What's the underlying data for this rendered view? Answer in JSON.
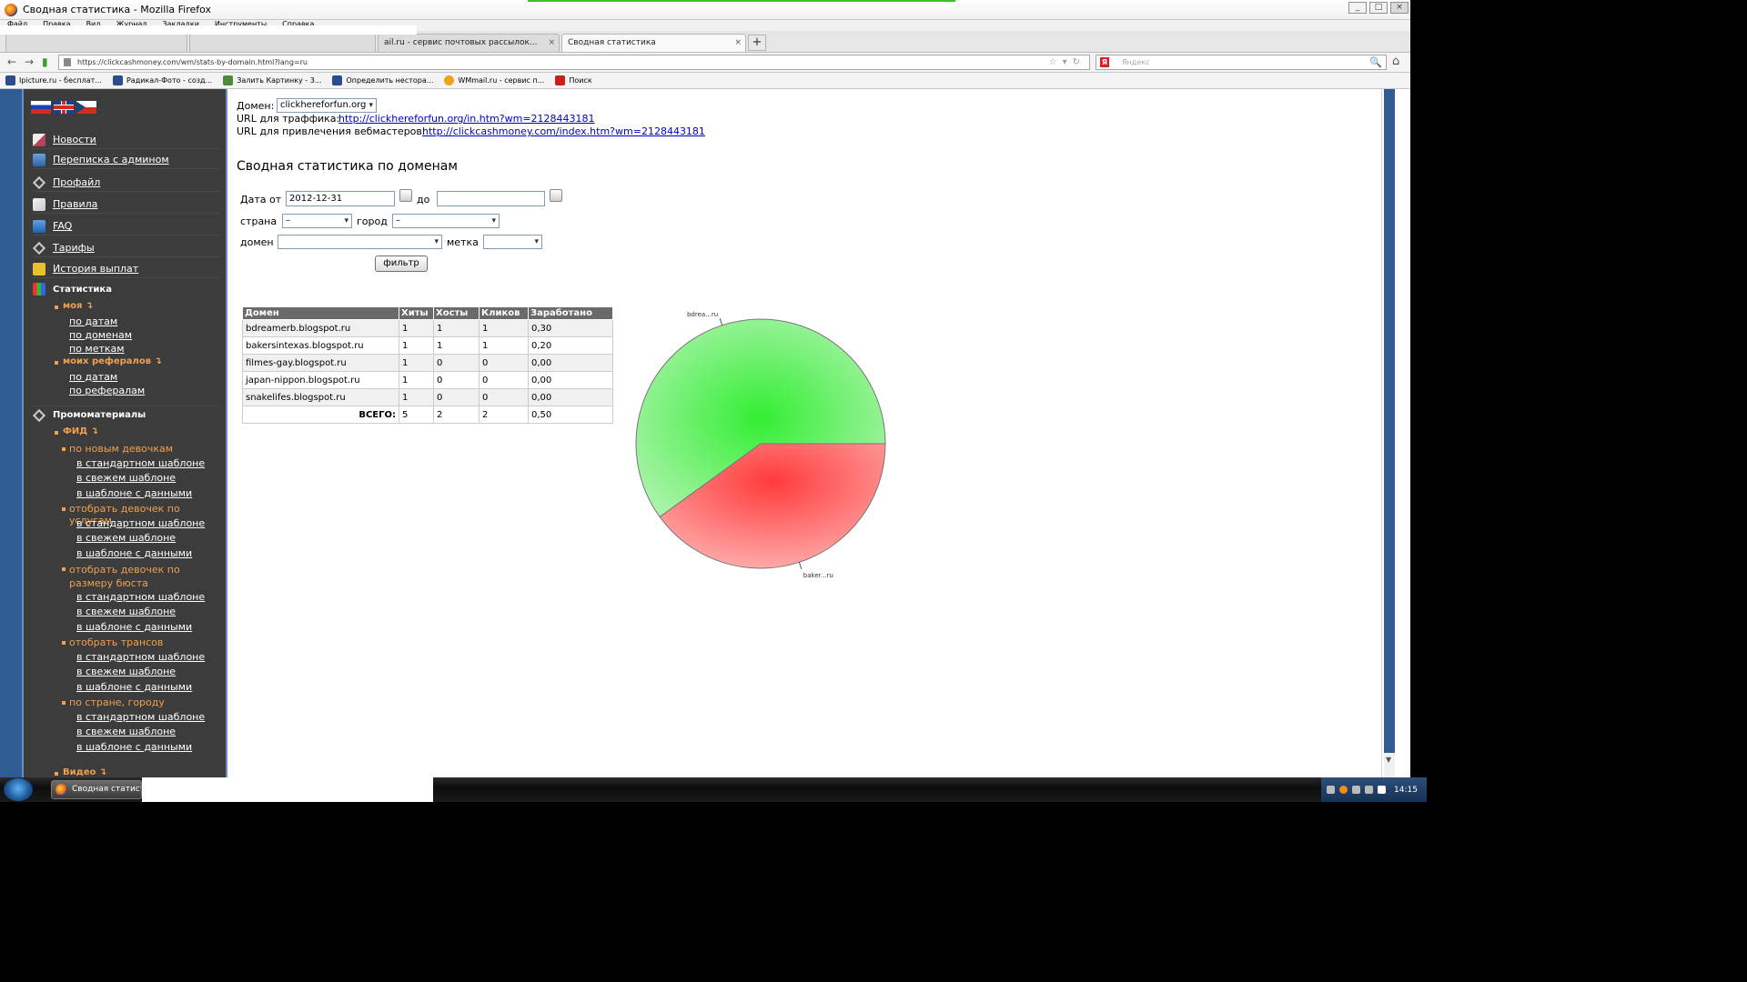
{
  "window": {
    "title": "Сводная статистика - Mozilla Firefox",
    "controls": [
      "_",
      "□",
      "×"
    ]
  },
  "menu": [
    "Файл",
    "Правка",
    "Вид",
    "Журнал",
    "Закладки",
    "Инструменты",
    "Справка"
  ],
  "tabs": [
    {
      "label": "",
      "active": false
    },
    {
      "label": "",
      "active": false
    },
    {
      "label": "ail.ru - сервис почтовых рассылок...",
      "active": false
    },
    {
      "label": "Сводная статистика",
      "active": true
    }
  ],
  "tab_close": "×",
  "new_tab": "+",
  "navbar": {
    "back": "←",
    "forward": "→",
    "url": "https://clickcashmoney.com/wm/stats-by-domain.html?lang=ru",
    "url_icons": "☆▾↻",
    "search_placeholder": "Яндекс",
    "search_engine": "Я",
    "search_icon": "🔍",
    "home_icon": "⌂"
  },
  "bookmarks": [
    {
      "label": "Ipicture.ru - бесплат...",
      "icon": "ipicture-icon"
    },
    {
      "label": "Радикал-Фото - созд...",
      "icon": "radikal-icon"
    },
    {
      "label": "Залить Картинку - 3...",
      "icon": "image-upload-icon"
    },
    {
      "label": "Определить нестора...",
      "icon": "ip-icon"
    },
    {
      "label": "WMmail.ru - сервис п...",
      "icon": "wmmail-icon"
    },
    {
      "label": "Поиск",
      "icon": "search-bookmark-icon"
    }
  ],
  "sidebar": {
    "items": [
      {
        "label": "Новости",
        "icon": "news-icon"
      },
      {
        "label": "Переписка с админом",
        "icon": "mail-icon"
      },
      {
        "label": "Профайл",
        "icon": "tools-icon"
      },
      {
        "label": "Правила",
        "icon": "rules-icon"
      },
      {
        "label": "FAQ",
        "icon": "faq-icon"
      },
      {
        "label": "Тарифы",
        "icon": "tools-icon"
      },
      {
        "label": "История выплат",
        "icon": "history-icon"
      }
    ],
    "stats_header": "Статистика",
    "my": "моя ↴",
    "my_links": [
      "по датам",
      "по доменам",
      "по меткам"
    ],
    "referrals": "моих рефералов ↴",
    "ref_links": [
      "по датам",
      "по рефералам"
    ],
    "promo_header": "Промоматериалы",
    "feed": "ФИД ↴",
    "feed_groups": [
      {
        "title": "по новым девочкам",
        "links": [
          "в стандартном шаблоне",
          "в свежем шаблоне",
          "в шаблоне с данными"
        ]
      },
      {
        "title": "отобрать девочек по услугам",
        "links": [
          "в стандартном шаблоне",
          "в свежем шаблоне",
          "в шаблоне с данными"
        ]
      },
      {
        "title": "отобрать девочек по размеру бюста",
        "links": [
          "в стандартном шаблоне",
          "в свежем шаблоне",
          "в шаблоне с данными"
        ]
      },
      {
        "title": "отобрать трансов",
        "links": [
          "в стандартном шаблоне",
          "в свежем шаблоне",
          "в шаблоне с данными"
        ]
      },
      {
        "title": "по стране, городу",
        "links": [
          "в стандартном шаблоне",
          "в свежем шаблоне",
          "в шаблоне с данными"
        ]
      }
    ],
    "video": "Видео ↴"
  },
  "main": {
    "domain_label": "Домен:",
    "domain_value": "clickhereforfun.org",
    "traffic_url_label": "URL для траффика:",
    "traffic_url": "http://clickhereforfun.org/in.htm?wm=2128443181",
    "webmaster_url_label": "URL для привлечения вебмастеров:",
    "webmaster_url": "http://clickcashmoney.com/index.htm?wm=2128443181",
    "heading": "Сводная статистика по доменам",
    "filter": {
      "date_from_label": "Дата от",
      "date_from": "2012-12-31",
      "date_to_label": "до",
      "date_to": "",
      "country_label": "страна",
      "country_value": "–",
      "city_label": "город",
      "city_value": "–",
      "domain_label": "домен",
      "domain_value": "",
      "tag_label": "метка",
      "tag_value": "",
      "button": "фильтр"
    },
    "table": {
      "headers": [
        "Домен",
        "Хиты",
        "Хосты",
        "Кликов",
        "Заработано"
      ],
      "rows": [
        [
          "bdreamerb.blogspot.ru",
          "1",
          "1",
          "1",
          "0,30"
        ],
        [
          "bakersintexas.blogspot.ru",
          "1",
          "1",
          "1",
          "0,20"
        ],
        [
          "filmes-gay.blogspot.ru",
          "1",
          "0",
          "0",
          "0,00"
        ],
        [
          "japan-nippon.blogspot.ru",
          "1",
          "0",
          "0",
          "0,00"
        ],
        [
          "snakelifes.blogspot.ru",
          "1",
          "0",
          "0",
          "0,00"
        ]
      ],
      "total_label": "ВСЕГО:",
      "total": [
        "5",
        "2",
        "2",
        "0,50"
      ]
    }
  },
  "chart_data": {
    "type": "pie",
    "labels": [
      "bdrea...ru",
      "baker...ru"
    ],
    "values": [
      0.3,
      0.2
    ],
    "colors": [
      "#3ee83e",
      "#ff4b4b"
    ]
  },
  "taskbar": {
    "task": "Сводная статистика",
    "clock": "14:15"
  }
}
